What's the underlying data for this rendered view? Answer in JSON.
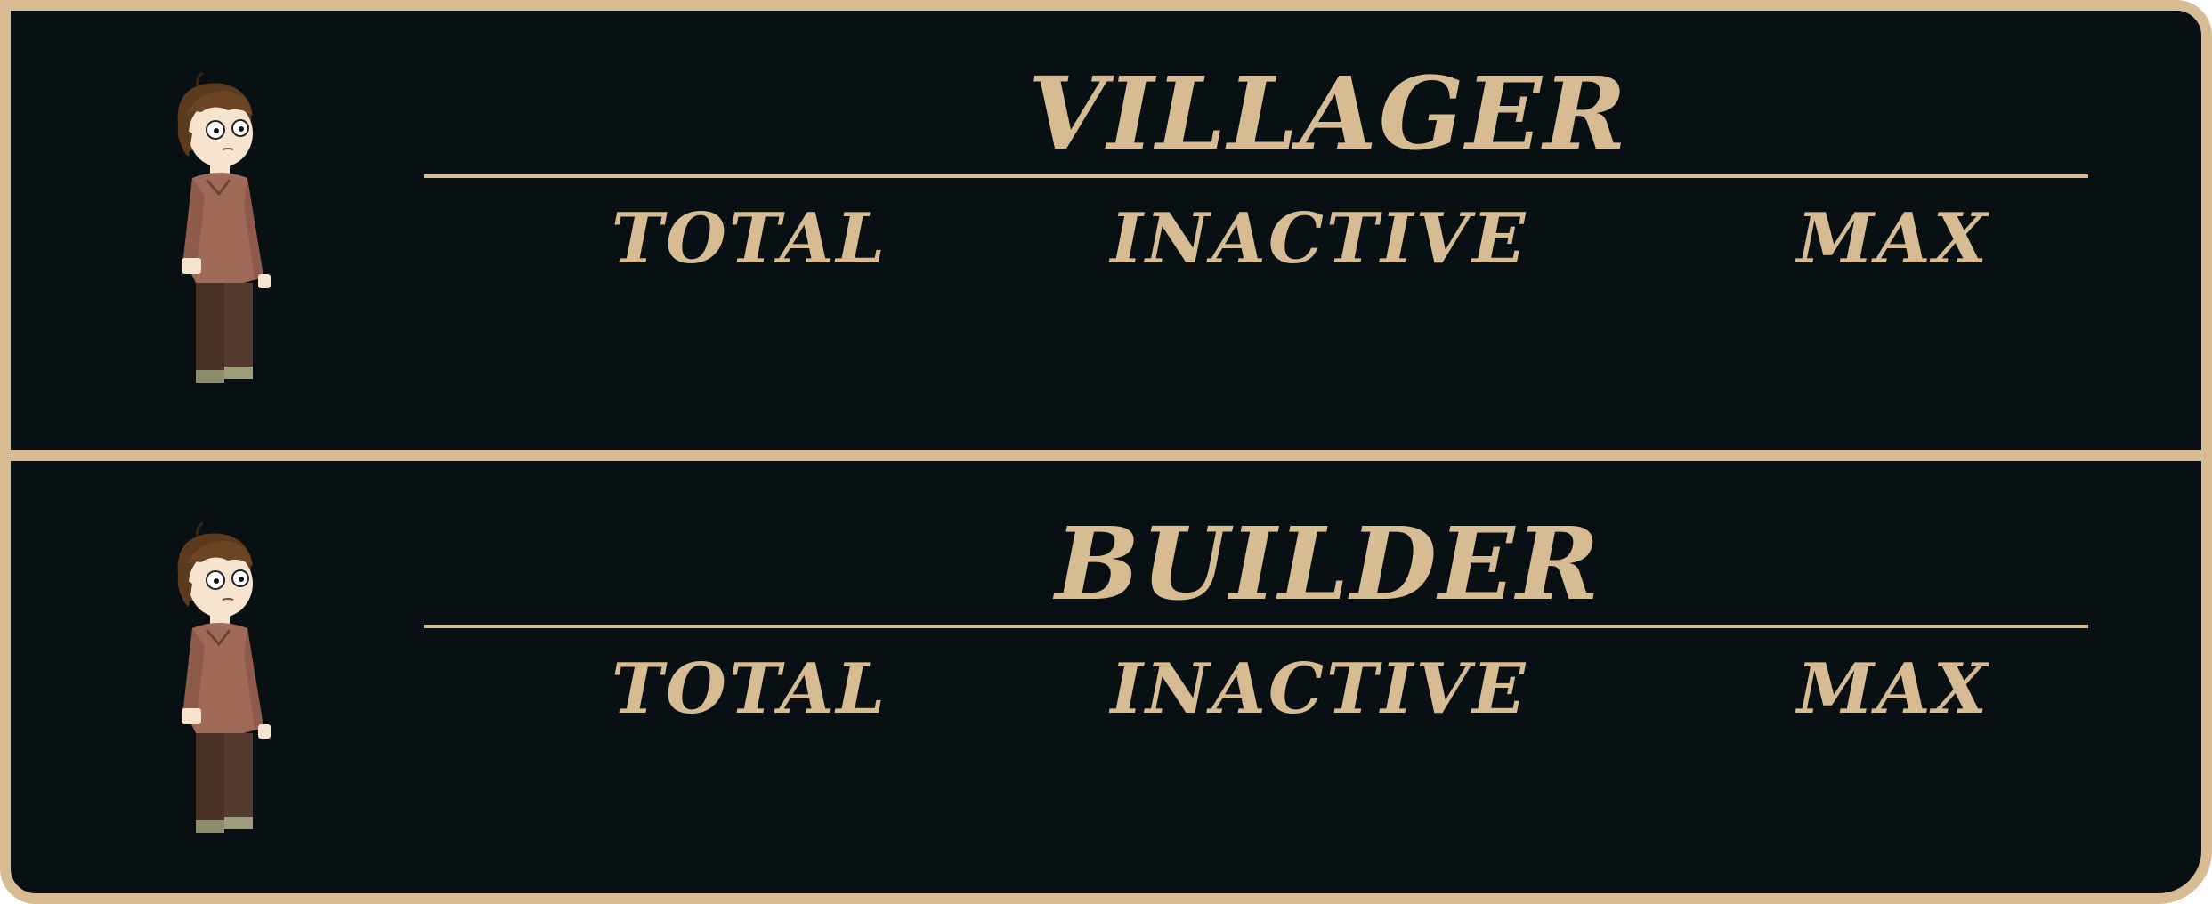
{
  "panels": [
    {
      "title": "VILLAGER",
      "avatar_icon": "villager-character-icon",
      "columns": {
        "total": "TOTAL",
        "inactive": "INACTIVE",
        "max": "MAX"
      }
    },
    {
      "title": "BUILDER",
      "avatar_icon": "builder-character-icon",
      "columns": {
        "total": "TOTAL",
        "inactive": "INACTIVE",
        "max": "MAX"
      }
    }
  ],
  "colors": {
    "background": "#091013",
    "accent": "#d6bb93"
  }
}
